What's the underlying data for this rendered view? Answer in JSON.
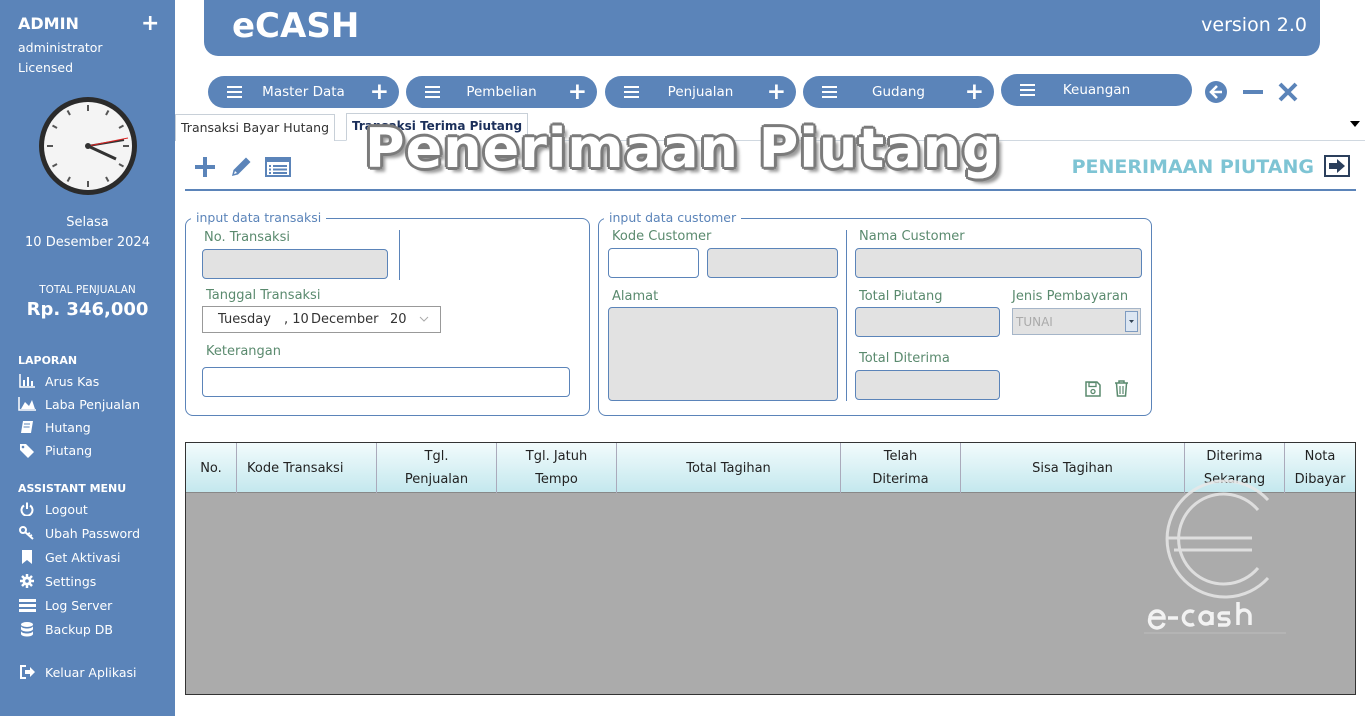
{
  "sidebar": {
    "user": "ADMIN",
    "role": "administrator",
    "license": "Licensed",
    "day": "Selasa",
    "date": "10 Desember 2024",
    "total_label": "TOTAL PENJUALAN",
    "total_value": "Rp. 346,000",
    "laporan_title": "LAPORAN",
    "laporan_items": [
      "Arus Kas",
      "Laba Penjualan",
      "Hutang",
      "Piutang"
    ],
    "assistant_title": "ASSISTANT MENU",
    "assistant_items": [
      "Logout",
      "Ubah Password",
      "Get Aktivasi",
      "Settings",
      "Log Server",
      "Backup DB"
    ],
    "exit_label": "Keluar Aplikasi"
  },
  "header": {
    "title": "eCASH",
    "version": "version 2.0"
  },
  "menu": [
    "Master Data",
    "Pembelian",
    "Penjualan",
    "Gudang",
    "Keuangan"
  ],
  "tabs": [
    "Transaksi Bayar Hutang",
    "Transaksi Terima Piutang"
  ],
  "page": {
    "banner": "Penerimaan Piutang",
    "title": "PENERIMAAN PIUTANG"
  },
  "trx_form": {
    "legend": "input data transaksi",
    "no_label": "No. Transaksi",
    "date_label": "Tanggal Transaksi",
    "date_day": "Tuesday",
    "date_num": ", 10",
    "date_month": "December",
    "date_year": "20",
    "note_label": "Keterangan"
  },
  "cust_form": {
    "legend": "input data customer",
    "code_label": "Kode Customer",
    "name_label": "Nama Customer",
    "address_label": "Alamat",
    "total_label": "Total Piutang",
    "payment_label": "Jenis Pembayaran",
    "payment_value": "TUNAI",
    "received_label": "Total Diterima"
  },
  "table": {
    "columns": [
      "No.",
      "Kode Transaksi",
      "Tgl. Penjualan",
      "Tgl. Jatuh Tempo",
      "Total Tagihan",
      "Telah Diterima",
      "Sisa Tagihan",
      "Diterima Sekarang",
      "Nota Dibayar"
    ]
  },
  "colors": {
    "primary": "#5b84b9",
    "accent": "#7ec4d4",
    "label": "#5a8a6e"
  }
}
